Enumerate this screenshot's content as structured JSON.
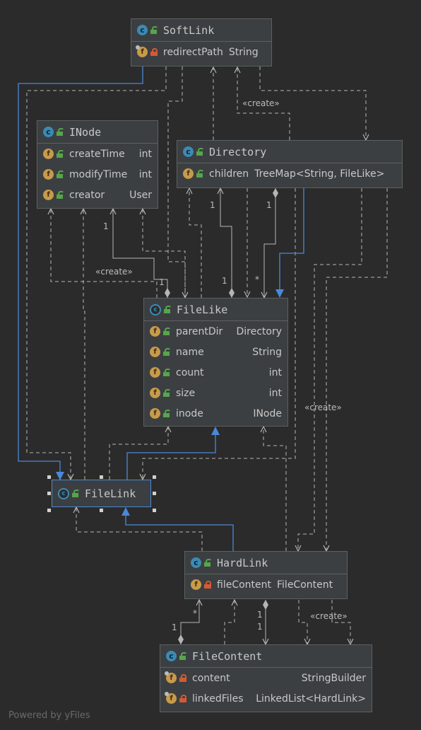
{
  "classes": {
    "softlink": {
      "name": "SoftLink",
      "fields": [
        {
          "name": "redirectPath",
          "type": "String"
        }
      ]
    },
    "inode": {
      "name": "INode",
      "fields": [
        {
          "name": "createTime",
          "type": "int"
        },
        {
          "name": "modifyTime",
          "type": "int"
        },
        {
          "name": "creator",
          "type": "User"
        }
      ]
    },
    "directory": {
      "name": "Directory",
      "fields": [
        {
          "name": "children",
          "type": "TreeMap<String, FileLike>"
        }
      ]
    },
    "filelike": {
      "name": "FileLike",
      "fields": [
        {
          "name": "parentDir",
          "type": "Directory"
        },
        {
          "name": "name",
          "type": "String"
        },
        {
          "name": "count",
          "type": "int"
        },
        {
          "name": "size",
          "type": "int"
        },
        {
          "name": "inode",
          "type": "INode"
        }
      ]
    },
    "filelink": {
      "name": "FileLink"
    },
    "hardlink": {
      "name": "HardLink",
      "fields": [
        {
          "name": "fileContent",
          "type": "FileContent"
        }
      ]
    },
    "filecontent": {
      "name": "FileContent",
      "fields": [
        {
          "name": "content",
          "type": "StringBuilder"
        },
        {
          "name": "linkedFiles",
          "type": "LinkedList<HardLink>"
        }
      ]
    }
  },
  "edge_labels": {
    "create": "«create»",
    "one": "1",
    "many": "*"
  },
  "icons": {
    "class": "c",
    "field": "f"
  },
  "colors": {
    "background": "#2b2b2b",
    "node": "#3c3f41",
    "edge": "#b5b5b5",
    "inheritance": "#4a88d8"
  },
  "footer": "Powered by yFiles"
}
